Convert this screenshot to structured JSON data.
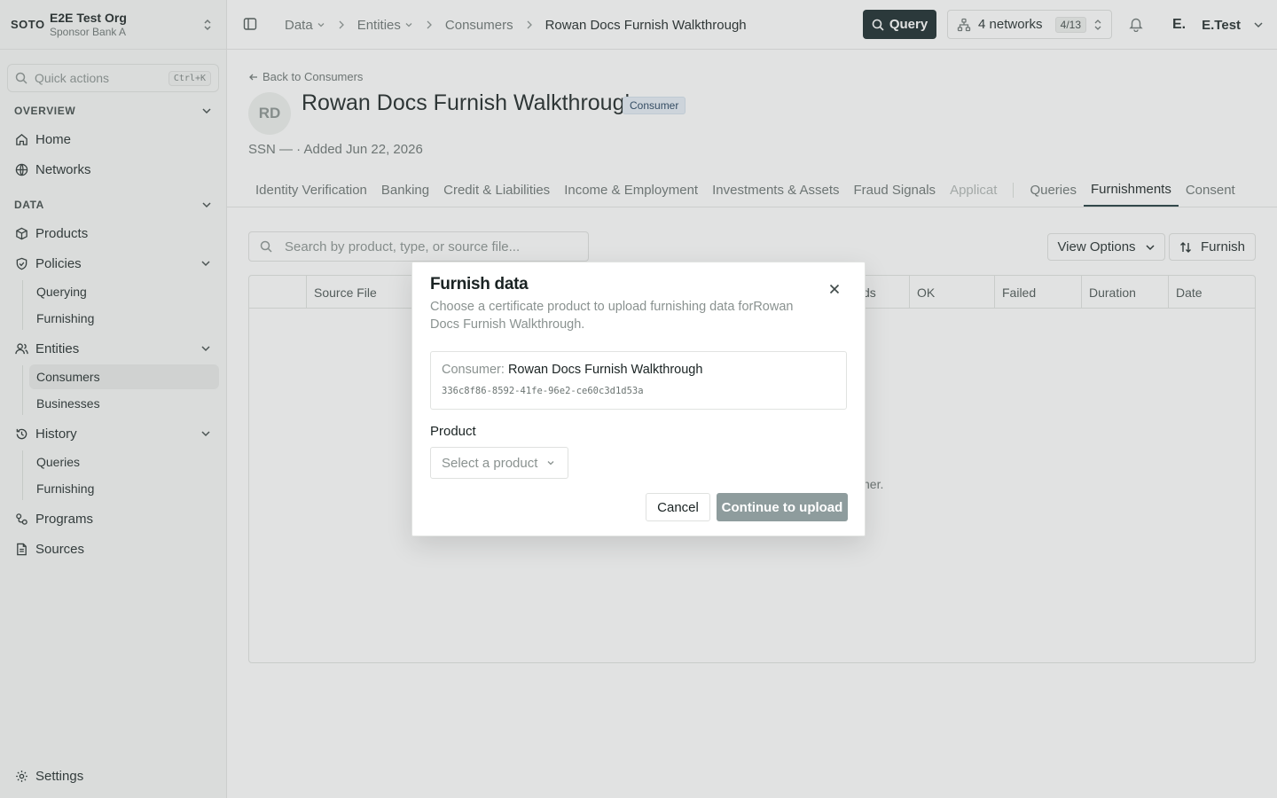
{
  "org": {
    "logo": "SOTO",
    "name": "E2E Test Org",
    "subtitle": "Sponsor Bank A"
  },
  "quick_actions": {
    "label": "Quick actions",
    "shortcut": "Ctrl+K"
  },
  "sidebar": {
    "overview_title": "OVERVIEW",
    "home": "Home",
    "networks": "Networks",
    "data_title": "DATA",
    "products": "Products",
    "policies": "Policies",
    "policies_sub": [
      "Querying",
      "Furnishing"
    ],
    "entities": "Entities",
    "entities_sub": [
      "Consumers",
      "Businesses"
    ],
    "history": "History",
    "history_sub": [
      "Queries",
      "Furnishing"
    ],
    "programs": "Programs",
    "sources": "Sources",
    "settings": "Settings"
  },
  "breadcrumb": [
    "Data",
    "Entities",
    "Consumers",
    "Rowan Docs Furnish Walkthrough"
  ],
  "topbar": {
    "query": "Query",
    "networks": "4 networks",
    "networks_count": "4/13",
    "user_initial": "E.",
    "user_name": "E.Test"
  },
  "page": {
    "back": "Back to Consumers",
    "avatar": "RD",
    "title": "Rowan Docs Furnish Walkthrough",
    "badge": "Consumer",
    "meta": "SSN — · Added Jun 22, 2026"
  },
  "tabs": [
    "Identity Verification",
    "Banking",
    "Credit & Liabilities",
    "Income & Employment",
    "Investments & Assets",
    "Fraud Signals",
    "Applicat",
    "Queries",
    "Furnishments",
    "Consent"
  ],
  "toolbar": {
    "search_placeholder": "Search by product, type, or source file...",
    "view_options": "View Options",
    "furnish": "Furnish"
  },
  "table": {
    "columns": [
      "Source File",
      "ds",
      "OK",
      "Failed",
      "Duration",
      "Date"
    ],
    "empty_fragment": "ner."
  },
  "dialog": {
    "title": "Furnish data",
    "description": "Choose a certificate product to upload furnishing data forRowan Docs Furnish Walkthrough.",
    "consumer_key": "Consumer:",
    "consumer_name": "Rowan Docs Furnish Walkthrough",
    "consumer_id": "336c8f86-8592-41fe-96e2-ce60c3d1d53a",
    "product_label": "Product",
    "product_placeholder": "Select a product",
    "cancel": "Cancel",
    "continue": "Continue to upload"
  }
}
